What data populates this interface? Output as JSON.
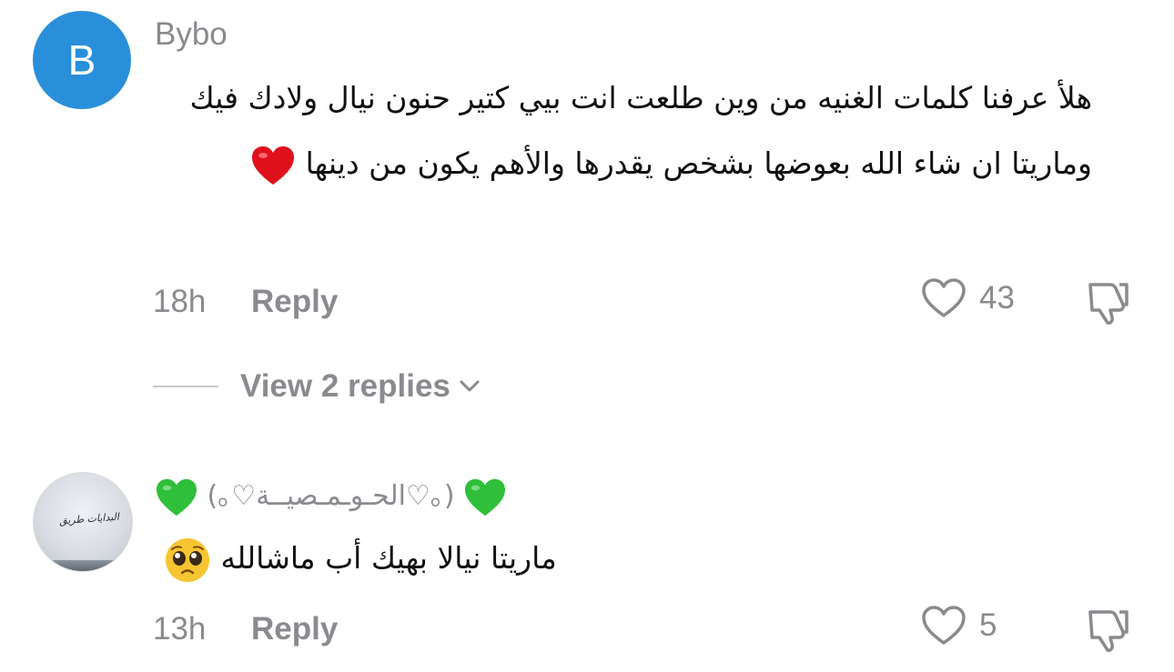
{
  "comments": [
    {
      "avatar_letter": "B",
      "username": "Bybo",
      "text": "هلأ عرفنا كلمات الغنيه من وين طلعت انت بيي كتير حنون نيال ولادك فيك وماريتا ان شاء الله بعوضها بشخص يقدرها والأهم يكون من دينها",
      "emoji": "red-heart-emoji",
      "time": "18h",
      "reply_label": "Reply",
      "likes": "43",
      "view_replies": "View 2 replies"
    },
    {
      "username": "(｡♡الحـوـمـصيــة♡｡)",
      "avatar_text": "البدايات طريق",
      "text": "ماريتا نيالا بهيك أب ماشالله",
      "emoji": "pleading-face-emoji",
      "time": "13h",
      "reply_label": "Reply",
      "likes": "5"
    }
  ],
  "colors": {
    "avatar_blue": "#2a8fda",
    "meta_gray": "#8a8a8f",
    "text": "#111111",
    "green_heart": "#2fbf3a",
    "red_heart": "#e0101c"
  }
}
